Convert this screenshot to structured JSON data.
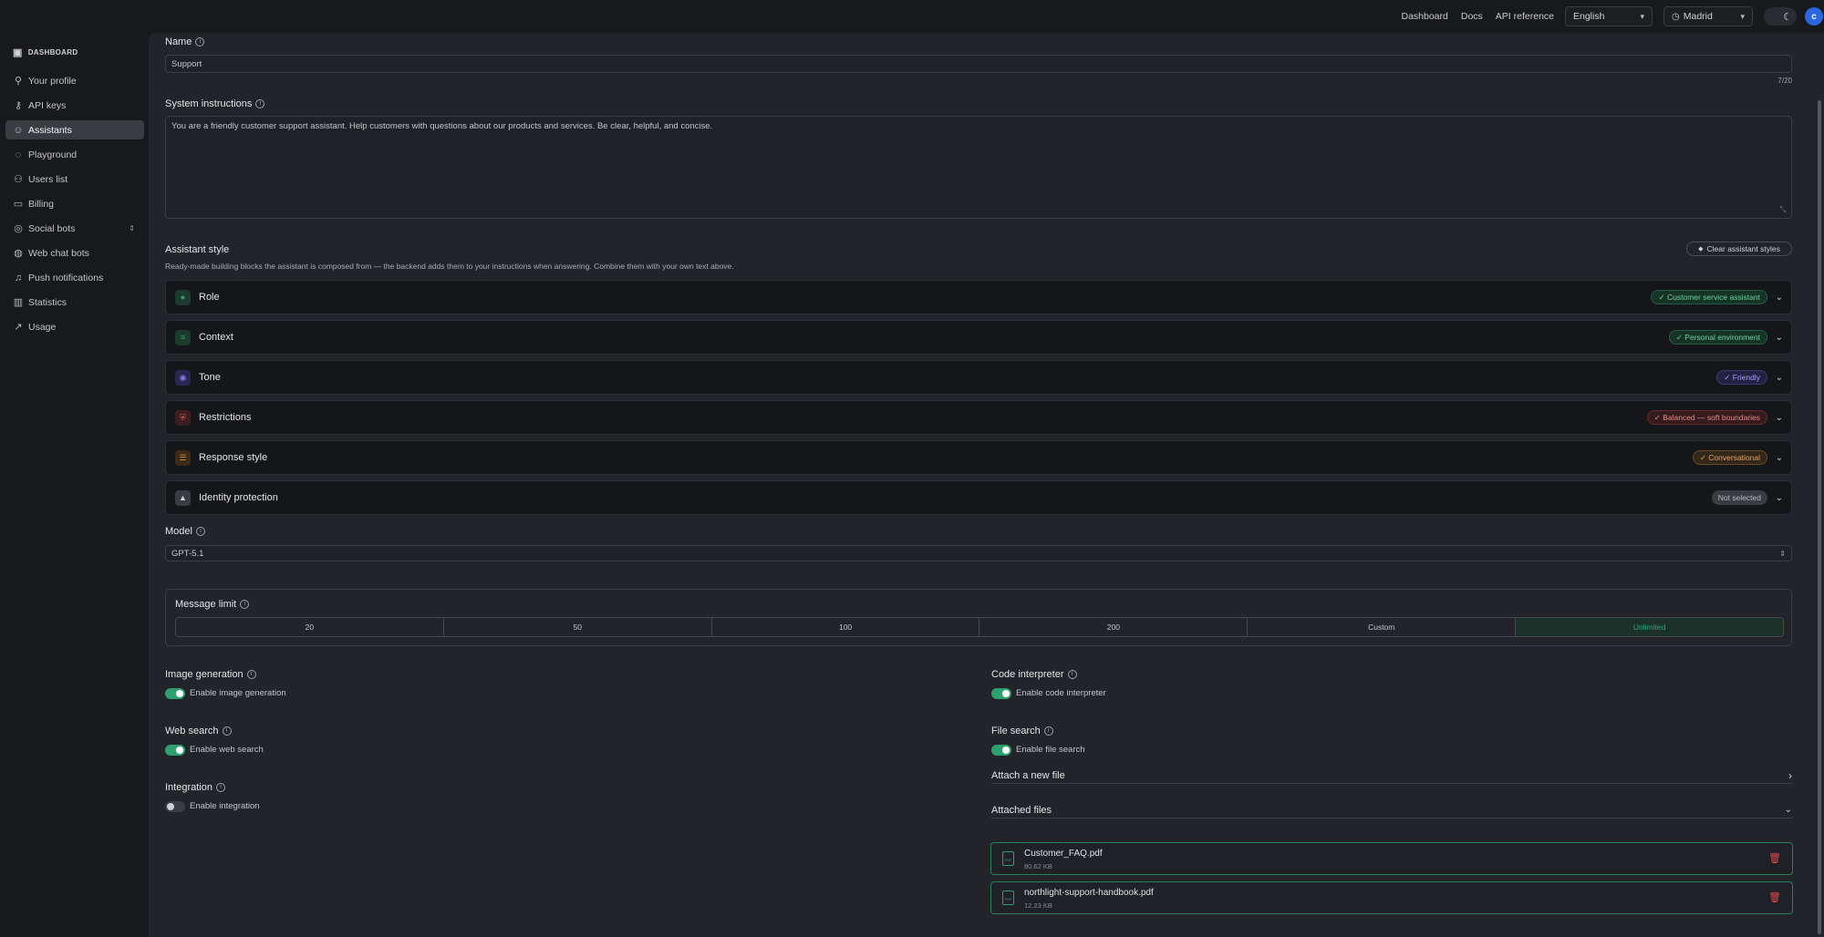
{
  "topnav": {
    "links": [
      "Dashboard",
      "Docs",
      "API reference"
    ],
    "language": "English",
    "timezone": "Madrid",
    "avatar_letter": "c"
  },
  "sidebar": {
    "header": "DASHBOARD",
    "items": [
      {
        "label": "Your profile",
        "icon": "user-icon"
      },
      {
        "label": "API keys",
        "icon": "key-icon"
      },
      {
        "label": "Assistants",
        "icon": "bot-icon",
        "active": true
      },
      {
        "label": "Playground",
        "icon": "chat-icon"
      },
      {
        "label": "Users list",
        "icon": "users-icon"
      },
      {
        "label": "Billing",
        "icon": "billing-icon"
      },
      {
        "label": "Social bots",
        "icon": "social-bots-icon"
      },
      {
        "label": "Web chat bots",
        "icon": "web-chat-icon"
      },
      {
        "label": "Push notifications",
        "icon": "bell-icon"
      },
      {
        "label": "Statistics",
        "icon": "bar-chart-icon"
      },
      {
        "label": "Usage",
        "icon": "usage-icon"
      }
    ]
  },
  "form": {
    "name_label": "Name",
    "name_value": "Support",
    "name_counter": "7/20",
    "sys_label": "System instructions",
    "sys_value": "You are a friendly customer support assistant. Help customers with questions about our products and services. Be clear, helpful, and concise.",
    "style_label": "Assistant style",
    "style_desc": "Ready-made building blocks the assistant is composed from — the backend adds them to your instructions when answering. Combine them with your own text above.",
    "clear_styles": "Clear assistant styles",
    "styles": [
      {
        "title": "Role",
        "badge": "✓ Customer service assistant",
        "color": "#2ea06f"
      },
      {
        "title": "Context",
        "badge": "✓ Personal environment",
        "color": "#2ea06f"
      },
      {
        "title": "Tone",
        "badge": "✓ Friendly",
        "color": "#7b68ee"
      },
      {
        "title": "Restrictions",
        "badge": "✓ Balanced — soft boundaries",
        "color": "#d9534f"
      },
      {
        "title": "Response style",
        "badge": "✓ Conversational",
        "color": "#d08a3a"
      },
      {
        "title": "Identity protection",
        "badge": "Not selected",
        "color": "#9fa0a4"
      }
    ],
    "model_label": "Model",
    "model_value": "GPT-5.1",
    "msg_limit_label": "Message limit",
    "msg_limit_options": [
      "20",
      "50",
      "100",
      "200",
      "Custom",
      "Unlimited"
    ],
    "msg_limit_selected": "Unlimited",
    "image_gen_label": "Image generation",
    "image_gen_toggle": "Enable image generation",
    "web_search_label": "Web search",
    "web_search_toggle": "Enable web search",
    "integration_label": "Integration",
    "integration_toggle": "Enable integration",
    "code_label": "Code interpreter",
    "code_toggle": "Enable code interpreter",
    "file_search_label": "File search",
    "file_search_toggle": "Enable file search",
    "attach_new": "Attach a new file",
    "attached_files": "Attached files",
    "files": [
      {
        "name": "Customer_FAQ.pdf",
        "size": "80.62 KB"
      },
      {
        "name": "northlight-support-handbook.pdf",
        "size": "12.23 KB"
      }
    ]
  }
}
